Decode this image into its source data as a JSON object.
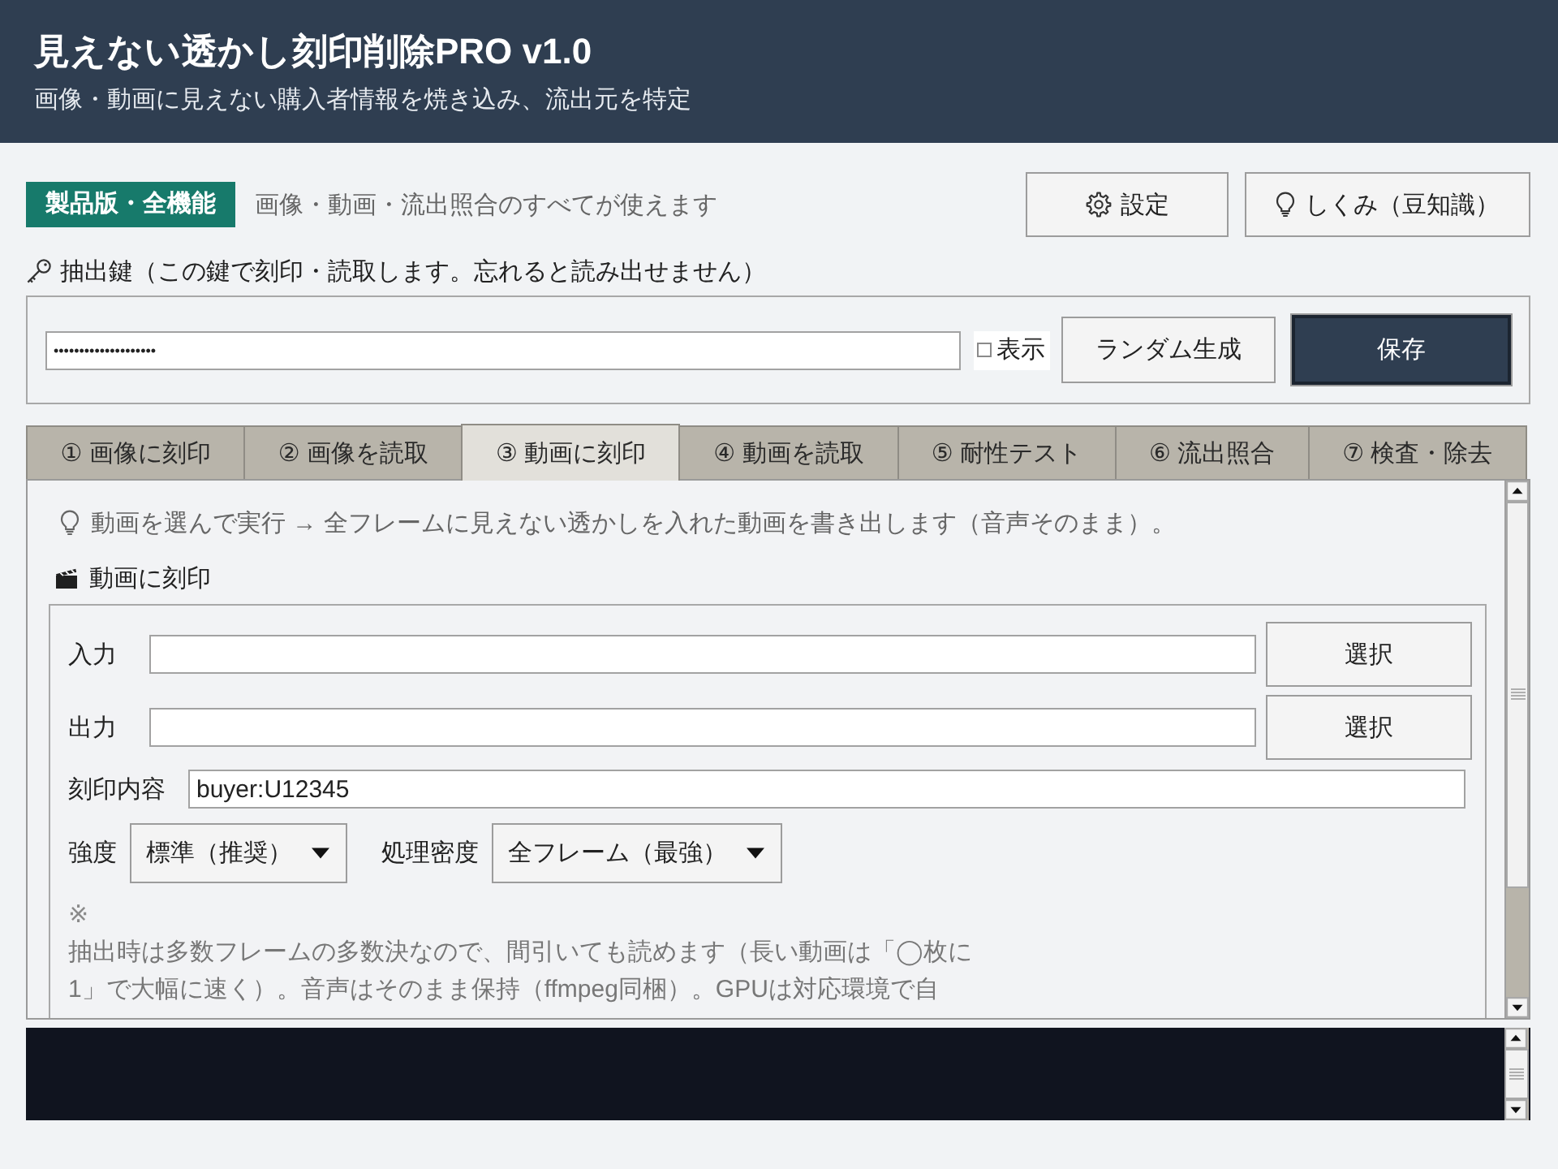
{
  "header": {
    "title": "見えない透かし刻印削除PRO v1.0",
    "subtitle": "画像・動画に見えない購入者情報を焼き込み、流出元を特定"
  },
  "license": {
    "badge": "製品版・全機能",
    "note": "画像・動画・流出照合のすべてが使えます"
  },
  "top_buttons": [
    {
      "label": "設定",
      "kind": "settings"
    },
    {
      "label": "しくみ（豆知識）",
      "kind": "tips"
    }
  ],
  "key": {
    "label": "抽出鍵（この鍵で刻印・読取します。忘れると読み出せません）",
    "value": "••••••••••••••••••••",
    "show": {
      "label": "表示",
      "checked": false
    },
    "buttons": [
      {
        "label": "ランダム生成",
        "kind": "normal"
      },
      {
        "label": "保存",
        "kind": "primary"
      }
    ]
  },
  "tabs": [
    {
      "label": "① 画像に刻印",
      "selected": false
    },
    {
      "label": "② 画像を読取",
      "selected": false
    },
    {
      "label": "③ 動画に刻印",
      "selected": true
    },
    {
      "label": "④ 動画を読取",
      "selected": false
    },
    {
      "label": "⑤ 耐性テスト",
      "selected": false
    },
    {
      "label": "⑥ 流出照合",
      "selected": false
    },
    {
      "label": "⑦ 検査・除去",
      "selected": false
    }
  ],
  "panel": {
    "tip": "動画を選んで実行 → 全フレームに見えない透かしを入れた動画を書き出します（音声そのまま）。",
    "section_title": "動画に刻印",
    "rows": [
      {
        "kind": "file",
        "label": "入力",
        "button": "選択"
      },
      {
        "kind": "file",
        "label": "出力",
        "button": "選択"
      },
      {
        "kind": "text",
        "label": "刻印内容",
        "value": "buyer:U12345"
      },
      {
        "kind": "selects",
        "selects": [
          {
            "label": "強度",
            "value": "標準（推奨）"
          },
          {
            "label": "処理密度",
            "value": "全フレーム（最強）"
          }
        ]
      }
    ],
    "note_mark": "※",
    "note": "抽出時は多数フレームの多数決なので、間引いても読めます（長い動画は「◯枚に1」で大幅に速く）。音声はそのまま保持（ffmpeg同梱）。GPUは対応環境で自"
  }
}
